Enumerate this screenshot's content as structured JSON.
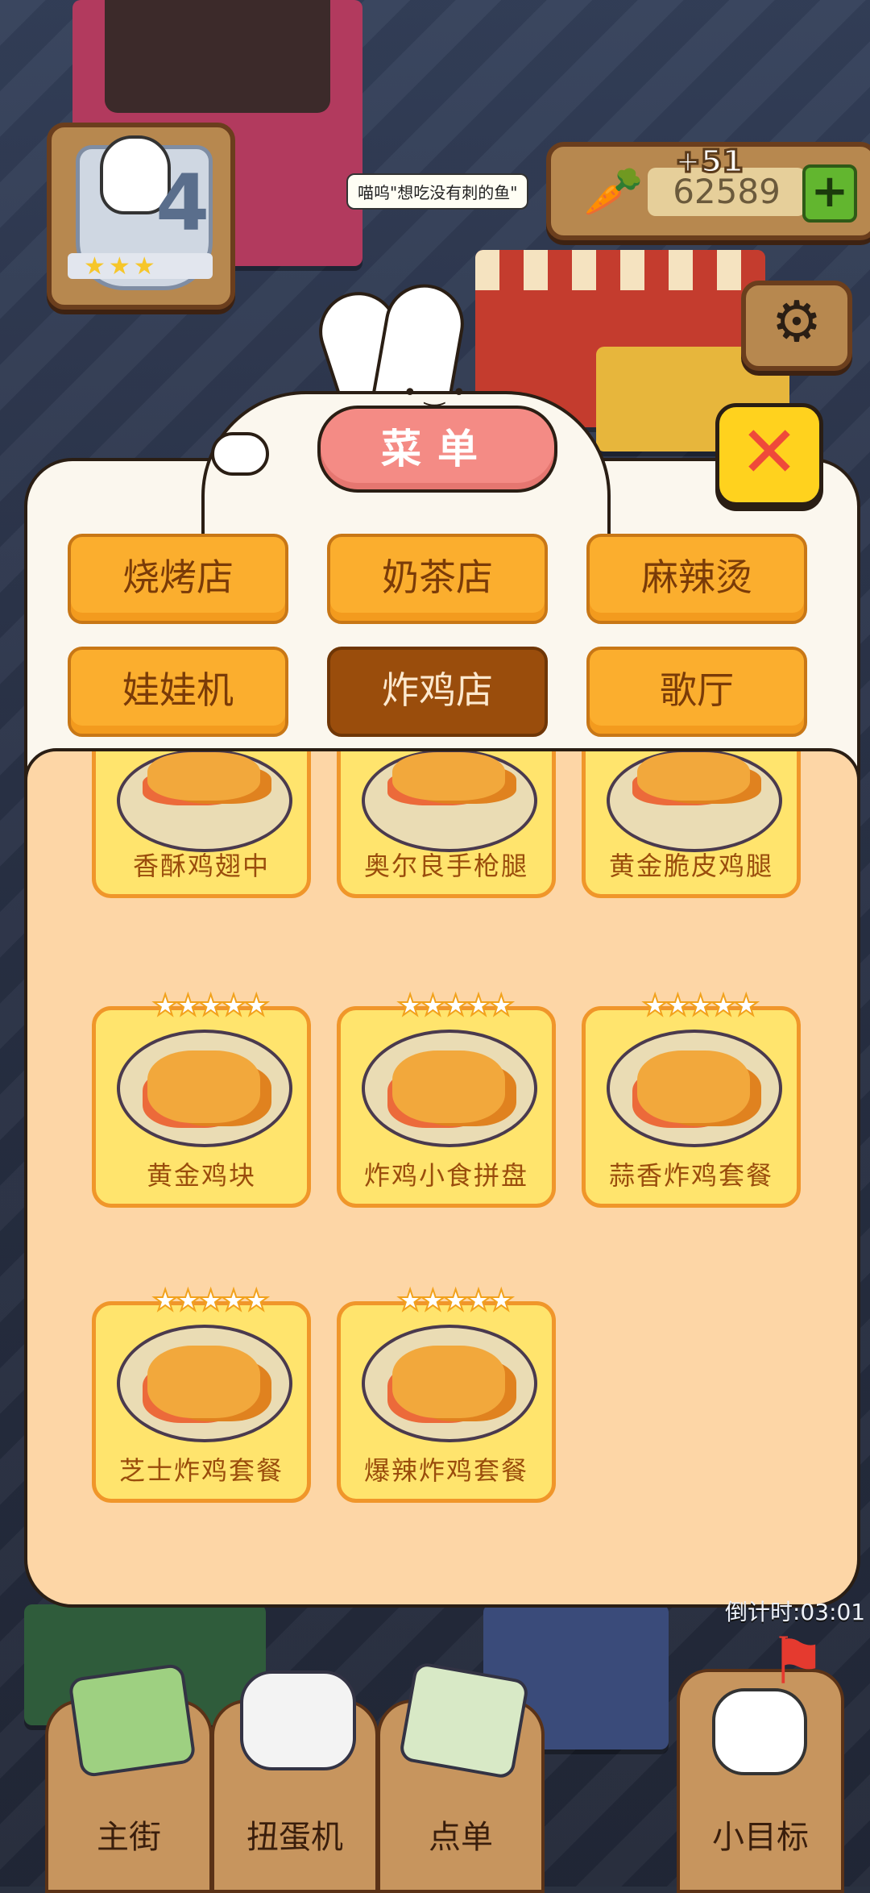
{
  "hud": {
    "level": "4",
    "level_stars": "★★★",
    "carrot_gain": "+51",
    "carrot_count": "62589",
    "plus": "+",
    "speech_bubble": "喵呜\"想吃没有刺的鱼\""
  },
  "menu": {
    "title": "菜单",
    "close": "✕",
    "categories": [
      {
        "label": "烧烤店",
        "active": false
      },
      {
        "label": "奶茶店",
        "active": false
      },
      {
        "label": "麻辣烫",
        "active": false
      },
      {
        "label": "娃娃机",
        "active": false
      },
      {
        "label": "炸鸡店",
        "active": true
      },
      {
        "label": "歌厅",
        "active": false
      }
    ],
    "items": [
      {
        "name": "香酥鸡翅中",
        "stars": ""
      },
      {
        "name": "奥尔良手枪腿",
        "stars": ""
      },
      {
        "name": "黄金脆皮鸡腿",
        "stars": ""
      },
      {
        "name": "黄金鸡块",
        "stars": "★★★★★"
      },
      {
        "name": "炸鸡小食拼盘",
        "stars": "★★★★★"
      },
      {
        "name": "蒜香炸鸡套餐",
        "stars": "★★★★★"
      },
      {
        "name": "芝士炸鸡套餐",
        "stars": "★★★★★"
      },
      {
        "name": "爆辣炸鸡套餐",
        "stars": "★★★★★"
      }
    ]
  },
  "timer": "倒计时:03:01",
  "nav": {
    "main_street": "主街",
    "gacha": "扭蛋机",
    "order": "点单",
    "goal": "小目标"
  },
  "colors": {
    "category_bg": "#fbae2e",
    "category_active_bg": "#9a4d0c",
    "title_pill": "#f48b85",
    "close_bg": "#ffd21e",
    "item_bg": "#ffe46d"
  }
}
